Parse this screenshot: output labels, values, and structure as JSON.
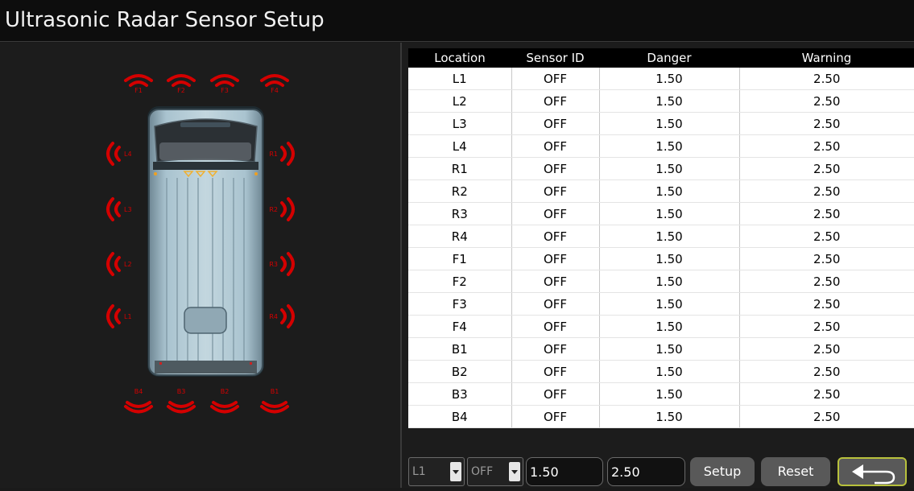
{
  "app": {
    "title": "Ultrasonic Radar Sensor Setup"
  },
  "colors": {
    "sensor": "#d40000",
    "header_bg": "#000000",
    "row_bg": "#ffffff",
    "button_bg": "#595959",
    "back_border": "#b8c13c"
  },
  "diagram": {
    "front_labels": [
      "F1",
      "F2",
      "F3",
      "F4"
    ],
    "left_labels": [
      "L4",
      "L3",
      "L2",
      "L1"
    ],
    "right_labels": [
      "R1",
      "R2",
      "R3",
      "R4"
    ],
    "rear_labels": [
      "B4",
      "B3",
      "B2",
      "B1"
    ]
  },
  "table": {
    "headers": [
      "Location",
      "Sensor ID",
      "Danger",
      "Warning"
    ],
    "rows": [
      [
        "L1",
        "OFF",
        "1.50",
        "2.50"
      ],
      [
        "L2",
        "OFF",
        "1.50",
        "2.50"
      ],
      [
        "L3",
        "OFF",
        "1.50",
        "2.50"
      ],
      [
        "L4",
        "OFF",
        "1.50",
        "2.50"
      ],
      [
        "R1",
        "OFF",
        "1.50",
        "2.50"
      ],
      [
        "R2",
        "OFF",
        "1.50",
        "2.50"
      ],
      [
        "R3",
        "OFF",
        "1.50",
        "2.50"
      ],
      [
        "R4",
        "OFF",
        "1.50",
        "2.50"
      ],
      [
        "F1",
        "OFF",
        "1.50",
        "2.50"
      ],
      [
        "F2",
        "OFF",
        "1.50",
        "2.50"
      ],
      [
        "F3",
        "OFF",
        "1.50",
        "2.50"
      ],
      [
        "F4",
        "OFF",
        "1.50",
        "2.50"
      ],
      [
        "B1",
        "OFF",
        "1.50",
        "2.50"
      ],
      [
        "B2",
        "OFF",
        "1.50",
        "2.50"
      ],
      [
        "B3",
        "OFF",
        "1.50",
        "2.50"
      ],
      [
        "B4",
        "OFF",
        "1.50",
        "2.50"
      ]
    ]
  },
  "controls": {
    "location_value": "L1",
    "sensor_value": "OFF",
    "danger_value": "1.50",
    "warning_value": "2.50",
    "setup_label": "Setup",
    "reset_label": "Reset",
    "back_icon": "back-arrow-icon"
  }
}
